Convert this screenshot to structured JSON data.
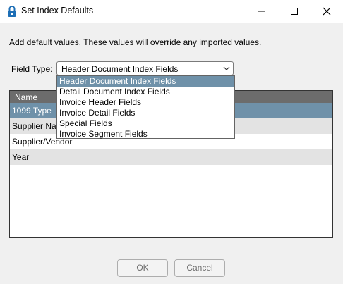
{
  "window": {
    "title": "Set Index Defaults",
    "icons": [
      "lock-icon",
      "minimize-icon",
      "maximize-icon",
      "close-icon"
    ]
  },
  "instruction": "Add default values. These values will override any imported values.",
  "field_type": {
    "label": "Field Type:",
    "selected": "Header Document Index Fields",
    "options": [
      "Header Document Index Fields",
      "Detail Document Index Fields",
      "Invoice Header Fields",
      "Invoice Detail Fields",
      "Special Fields",
      "Invoice Segment Fields"
    ],
    "highlighted_option": "Header Document Index Fields"
  },
  "grid": {
    "column_header": "Name",
    "rows": [
      "1099 Type",
      "Supplier Name",
      "Supplier/Vendor",
      "Year"
    ]
  },
  "buttons": {
    "ok": "OK",
    "cancel": "Cancel"
  },
  "colors": {
    "selection": "#6f91a9",
    "header_bg": "#6c6c6c",
    "alt_row": "#e3e3e3",
    "dialog_bg": "#f0f0f0"
  }
}
